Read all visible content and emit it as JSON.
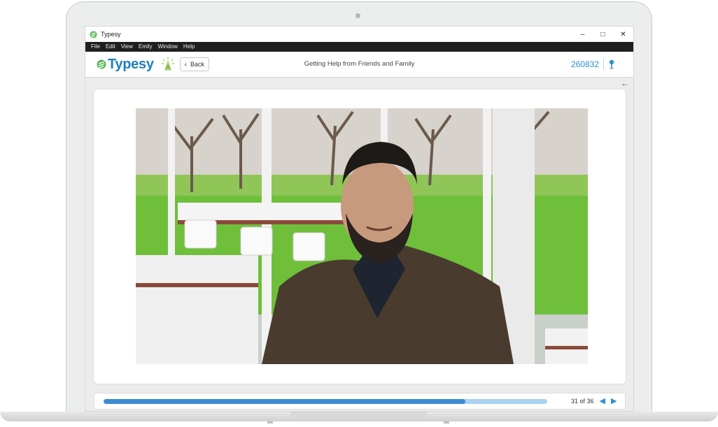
{
  "window": {
    "app_title": "Typesy",
    "minimize": "–",
    "maximize": "□",
    "close": "✕"
  },
  "menu": [
    "File",
    "Edit",
    "View",
    "Emily",
    "Window",
    "Help"
  ],
  "header": {
    "logo_text": "Typesy",
    "back_label": "Back",
    "lesson_title": "Getting Help from Friends and Family",
    "points": "260832"
  },
  "footer": {
    "page_count": "31 of 36",
    "progress": 0.815
  },
  "colors": {
    "accent": "#2d8fd0",
    "progress_fill": "#3d8bd6",
    "progress_track": "#a9d2f0",
    "menubar": "#1e1f21"
  },
  "icons": {
    "back": "chevron-left-icon",
    "collapse": "arrow-left-icon",
    "prev": "triangle-left-icon",
    "next": "triangle-right-icon",
    "pin": "pin-icon",
    "lamp": "lamp-icon"
  }
}
